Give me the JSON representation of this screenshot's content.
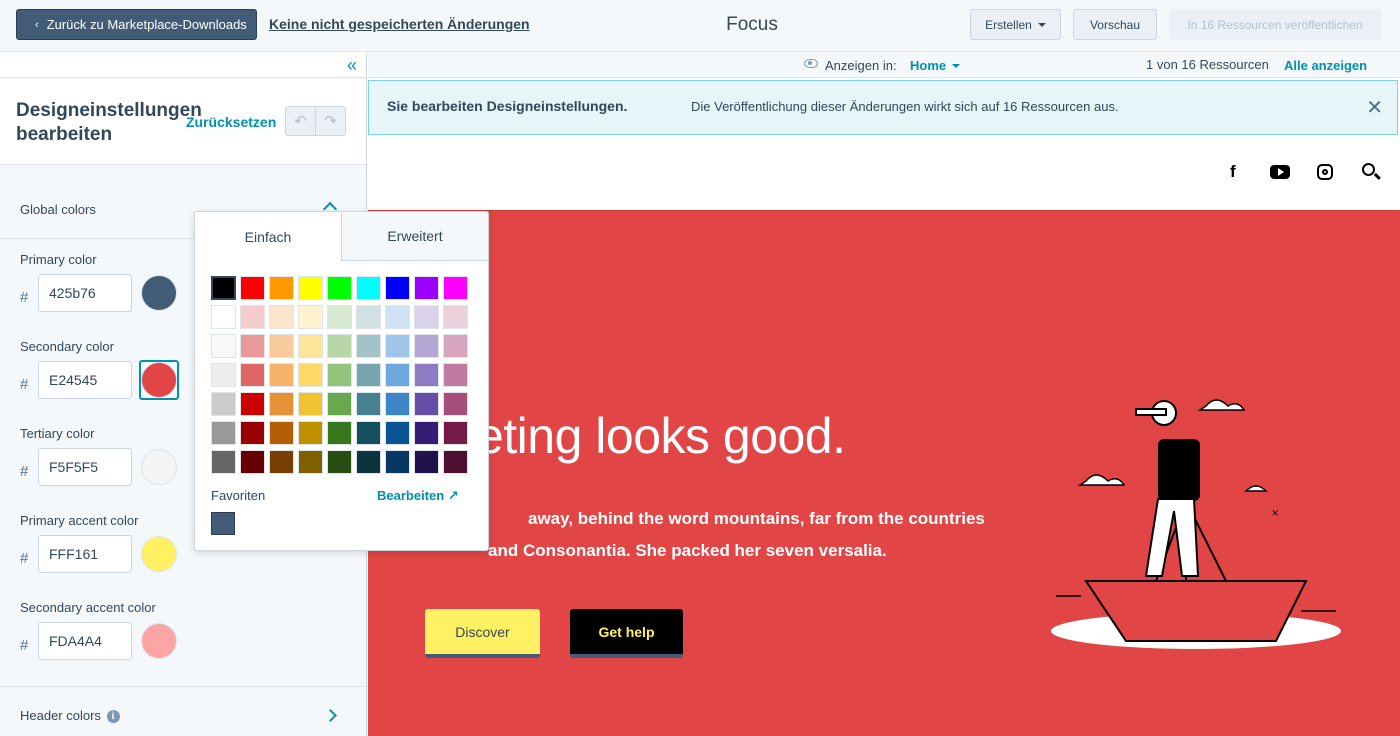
{
  "topbar": {
    "back_label": "Zurück zu Marketplace-Downloads",
    "unsaved_label": "Keine nicht gespeicherten Änderungen",
    "title": "Focus",
    "create_label": "Erstellen",
    "preview_label": "Vorschau",
    "publish_label": "In 16 Ressourcen veröffentlichen"
  },
  "sidebar": {
    "title": "Designeinstellungen bearbeiten",
    "reset_label": "Zurücksetzen",
    "global_colors_label": "Global colors",
    "colors": [
      {
        "label": "Primary color",
        "hex": "425b76",
        "swatch": "#425b76"
      },
      {
        "label": "Secondary color",
        "hex": "E24545",
        "swatch": "#e24545"
      },
      {
        "label": "Tertiary color",
        "hex": "F5F5F5",
        "swatch": "#f5f5f5"
      },
      {
        "label": "Primary accent color",
        "hex": "FFF161",
        "swatch": "#fff161"
      },
      {
        "label": "Secondary accent color",
        "hex": "FDA4A4",
        "swatch": "#fda4a4"
      }
    ],
    "header_colors_label": "Header colors"
  },
  "preview_bar": {
    "show_in_label": "Anzeigen in:",
    "show_in_value": "Home",
    "resource_count": "1 von 16 Ressourcen",
    "show_all_label": "Alle anzeigen"
  },
  "alert": {
    "title": "Sie bearbeiten Designeinstellungen.",
    "text": "Die Veröffentlichung dieser Änderungen wirkt sich auf 16 Ressourcen aus."
  },
  "site": {
    "hero_title": "arketing looks good.",
    "hero_sub_1": "away, behind the word mountains, far from the countries",
    "hero_sub_2": "and Consonantia. She packed her seven versalia.",
    "discover_label": "Discover",
    "help_label": "Get help"
  },
  "picker": {
    "tab_simple": "Einfach",
    "tab_advanced": "Erweitert",
    "favorites_label": "Favoriten",
    "edit_label": "Bearbeiten",
    "palette": [
      [
        "#000000",
        "#ff0000",
        "#ff9900",
        "#ffff00",
        "#00ff00",
        "#00ffff",
        "#0000ff",
        "#9900ff",
        "#ff00ff"
      ],
      [
        "#ffffff",
        "#f4cccc",
        "#fce5cd",
        "#fff2cc",
        "#d9ead3",
        "#d0e0e3",
        "#cfe2f3",
        "#d9d2e9",
        "#ead1dc"
      ],
      [
        "#f8f8f8",
        "#ea9999",
        "#f9cb9c",
        "#ffe599",
        "#b6d7a8",
        "#a2c4c9",
        "#9fc5e8",
        "#b4a7d6",
        "#d5a6bd"
      ],
      [
        "#eeeeee",
        "#e06666",
        "#f6b26b",
        "#ffd966",
        "#93c47d",
        "#76a5af",
        "#6fa8dc",
        "#8e7cc3",
        "#c27ba0"
      ],
      [
        "#cccccc",
        "#cc0000",
        "#e69138",
        "#f1c232",
        "#6aa84f",
        "#45818e",
        "#3d85c6",
        "#674ea7",
        "#a64d79"
      ],
      [
        "#999999",
        "#990000",
        "#b45f06",
        "#bf9000",
        "#38761d",
        "#134f5c",
        "#0b5394",
        "#351c75",
        "#741b47"
      ],
      [
        "#666666",
        "#660000",
        "#783f04",
        "#7f6000",
        "#274e13",
        "#0c343d",
        "#073763",
        "#20124d",
        "#4c1130"
      ]
    ],
    "favorite_color": "#425b76"
  }
}
